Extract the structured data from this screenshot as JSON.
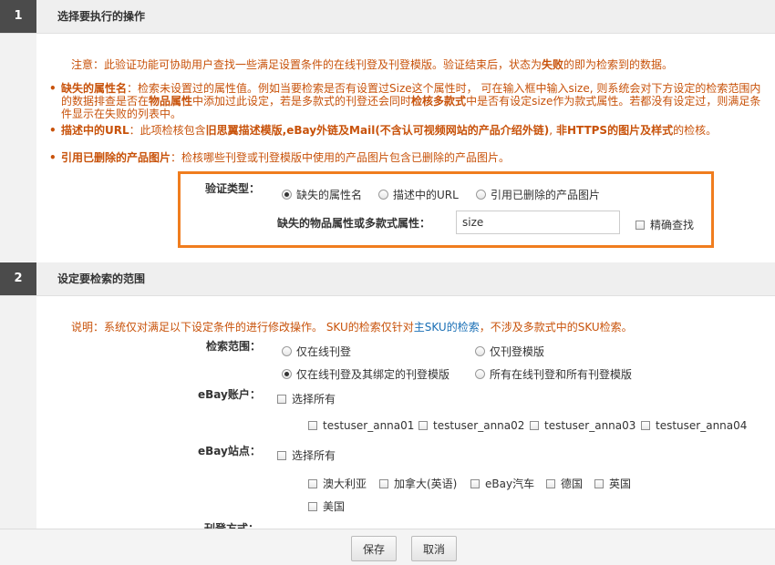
{
  "section1": {
    "number": "1",
    "title": "选择要执行的操作",
    "note": "注意：此验证功能可协助用户查找一些满足设置条件的在线刊登及刊登模版。验证结束后，状态为",
    "note_fail": "失败",
    "note_tail": "的即为检索到的数据。",
    "bullets": [
      {
        "head": "缺失的属性名",
        "t1": "：检索未设置过的属性值。例如当要检索是否有设置过Size这个属性时，  可在输入框中输入size, 则系统会对下方设定的检索范围内的数据排查是否在",
        "b1": "物品属性",
        "t2": "中添加过此设定，若是多款式的刊登还会同时",
        "b2": "检核多款式",
        "t3": "中是否有设定size作为款式属性。若都没有设定过，则满足条件显示在失败的列表中。"
      },
      {
        "head": "描述中的URL",
        "t1": "：此项检核包含",
        "b1": "旧思翼描述模版,eBay外链及Mail(不含认可视频网站的产品介绍外链)",
        "t2": ", ",
        "b2": "非HTTPS的图片及样式",
        "t3": "的检核。"
      },
      {
        "head": "引用已删除的产品图片",
        "t1": "：检核哪些刊登或刊登模版中使用的产品图片包含已删除的产品图片。",
        "b1": "",
        "t2": "",
        "b2": "",
        "t3": ""
      }
    ],
    "verify_type_label": "验证类型：",
    "verify_options": [
      "缺失的属性名",
      "描述中的URL",
      "引用已删除的产品图片"
    ],
    "verify_selected": 0,
    "attr_label": "缺失的物品属性或多款式属性：",
    "attr_value": "size",
    "exact_search_label": "精确查找"
  },
  "section2": {
    "number": "2",
    "title": "设定要检索的范围",
    "note_prefix": "说明：系统仅对满足以下设定条件的进行修改操作。 SKU的检索仅针对",
    "note_link": "主SKU的检索",
    "note_suffix": "，不涉及多款式中的SKU检索。",
    "scope_label": "检索范围：",
    "scope_options": [
      "仅在线刊登",
      "仅刊登模版",
      "仅在线刊登及其绑定的刊登模版",
      "所有在线刊登和所有刊登模版"
    ],
    "scope_selected": 2,
    "account_label": "eBay账户：",
    "select_all": "选择所有",
    "accounts": [
      "testuser_anna01",
      "testuser_anna02",
      "testuser_anna03",
      "testuser_anna04"
    ],
    "site_label": "eBay站点：",
    "sites": [
      "澳大利亚",
      "加拿大(英语)",
      "eBay汽车",
      "德国",
      "英国",
      "美国"
    ],
    "listing_type_label": "刊登方式："
  },
  "footer": {
    "save": "保存",
    "cancel": "取消"
  }
}
